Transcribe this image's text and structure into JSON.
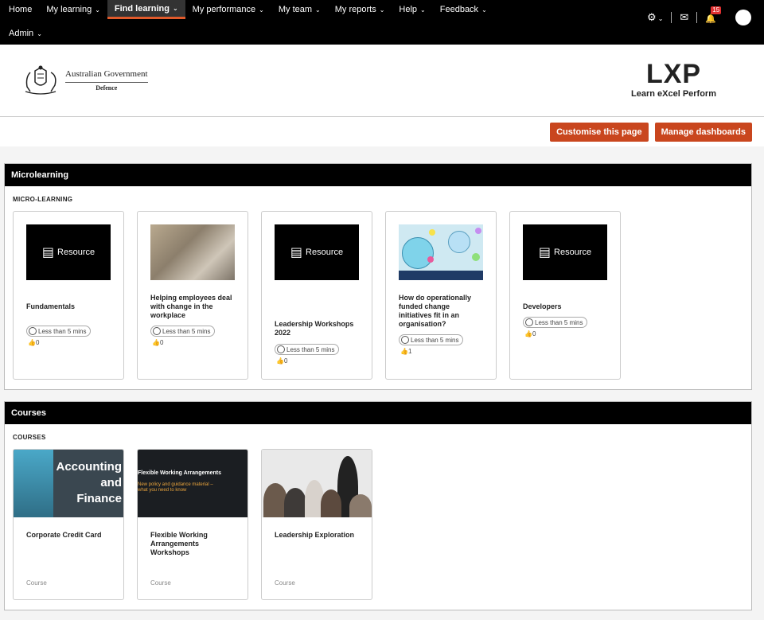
{
  "nav": {
    "items": [
      {
        "label": "Home",
        "chev": ""
      },
      {
        "label": "My learning",
        "chev": "⌄"
      },
      {
        "label": "Find learning",
        "chev": "⌄"
      },
      {
        "label": "My performance",
        "chev": "⌄"
      },
      {
        "label": "My team",
        "chev": "⌄"
      },
      {
        "label": "My reports",
        "chev": "⌄"
      },
      {
        "label": "Help",
        "chev": "⌄"
      },
      {
        "label": "Feedback",
        "chev": "⌄"
      }
    ],
    "admin": {
      "label": "Admin",
      "chev": "⌄"
    },
    "notification_count": "15",
    "icons": {
      "settings": "⚙",
      "settings_chev": "⌄",
      "mail": "✉",
      "bell": "🔔"
    }
  },
  "header": {
    "gov_line": "Australian Government",
    "dept_line": "Defence",
    "brand": "LXP",
    "brand_tagline": "Learn eXcel Perform"
  },
  "actions": {
    "customise": "Customise this page",
    "manage": "Manage dashboards"
  },
  "microlearning": {
    "heading": "Microlearning",
    "subheading": "MICRO-LEARNING",
    "resource_label": "Resource",
    "cards": [
      {
        "title": "Fundamentals",
        "duration": "Less than 5 mins",
        "likes": "0"
      },
      {
        "title": "Helping employees deal with change in the workplace",
        "duration": "Less than 5 mins",
        "likes": "0"
      },
      {
        "title": "Leadership Workshops 2022",
        "duration": "Less than 5 mins",
        "likes": "0"
      },
      {
        "title": "How do operationally funded change initiatives fit in an organisation?",
        "duration": "Less than 5 mins",
        "likes": "1"
      },
      {
        "title": "Developers",
        "duration": "Less than 5 mins",
        "likes": "0"
      }
    ]
  },
  "courses": {
    "heading": "Courses",
    "subheading": "COURSES",
    "cards": [
      {
        "title": "Corporate Credit Card",
        "type": "Course",
        "thumb_title_1": "Accounting",
        "thumb_title_2": "and",
        "thumb_title_3": "Finance"
      },
      {
        "title": "Flexible Working Arrangements Workshops",
        "type": "Course",
        "thumb_title_1": "Flexible Working Arrangements",
        "thumb_title_2": "New policy and guidance material –",
        "thumb_title_3": "what you need to know"
      },
      {
        "title": "Leadership Exploration",
        "type": "Course"
      }
    ]
  }
}
